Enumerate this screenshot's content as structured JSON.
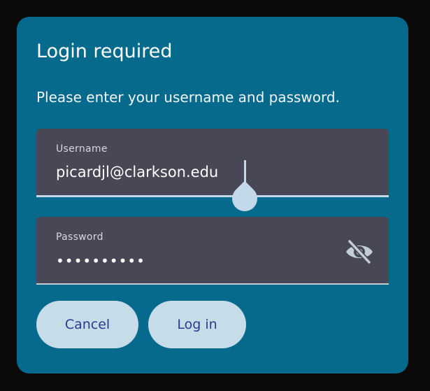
{
  "dialog": {
    "title": "Login required",
    "message": "Please enter your username and password."
  },
  "username": {
    "label": "Username",
    "value": "picardjl@clarkson.edu"
  },
  "password": {
    "label": "Password",
    "value": "••••••••••",
    "toggle_icon": "eye-off-icon"
  },
  "buttons": {
    "cancel": "Cancel",
    "login": "Log in"
  },
  "colors": {
    "dialog_bg": "#066a8c",
    "field_bg": "#474755",
    "accent": "#c3d8e8",
    "button_text": "#2c3a8c"
  }
}
